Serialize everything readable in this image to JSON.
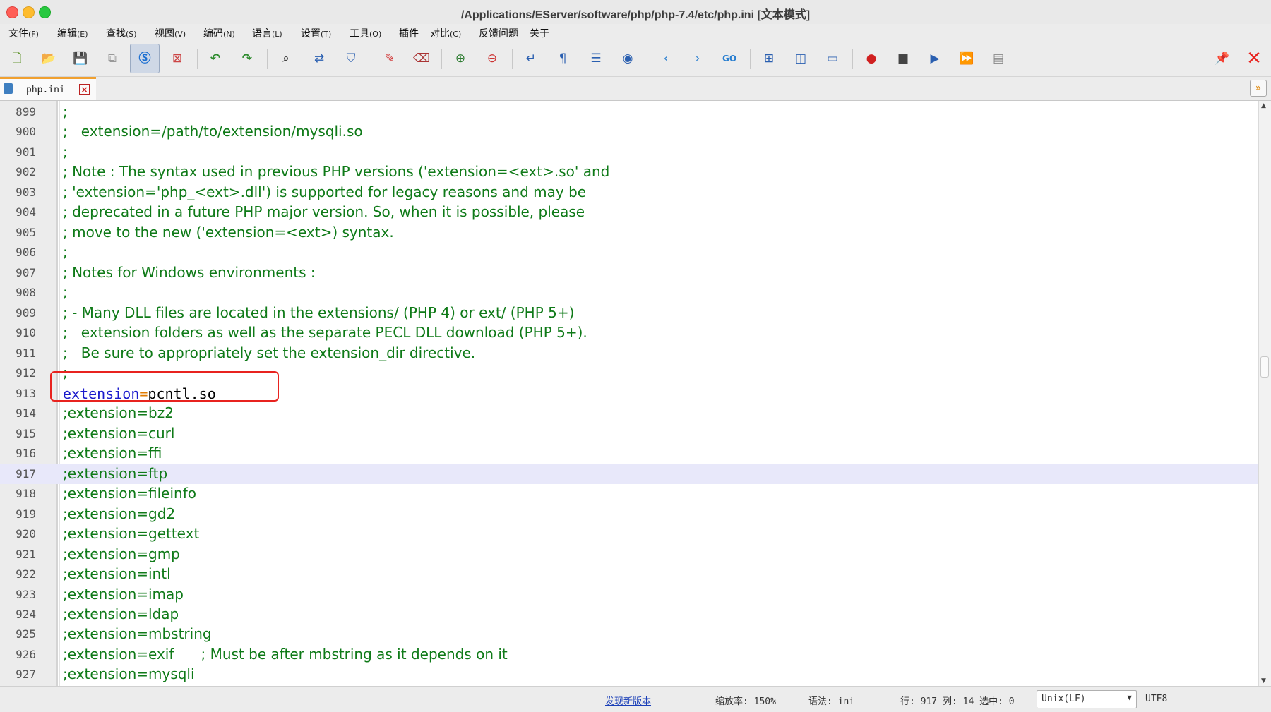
{
  "window": {
    "title": "/Applications/EServer/software/php/php-7.4/etc/php.ini [文本模式]"
  },
  "menu": [
    {
      "label": "文件",
      "accel": "(F)"
    },
    {
      "label": "编辑",
      "accel": "(E)"
    },
    {
      "label": "查找",
      "accel": "(S)"
    },
    {
      "label": "视图",
      "accel": "(V)"
    },
    {
      "label": "编码",
      "accel": "(N)"
    },
    {
      "label": "语言",
      "accel": "(L)"
    },
    {
      "label": "设置",
      "accel": "(T)"
    },
    {
      "label": "工具",
      "accel": "(O)"
    },
    {
      "label": "插件",
      "accel": ""
    },
    {
      "label": "对比",
      "accel": "(C)"
    },
    {
      "label": "反馈问题",
      "accel": ""
    },
    {
      "label": "关于",
      "accel": ""
    }
  ],
  "toolbar": {
    "icons": [
      "new-file-icon",
      "open-file-icon",
      "save-icon",
      "save-all-icon",
      "text-mode-icon",
      "close-file-icon",
      "undo-icon",
      "redo-icon",
      "find-icon",
      "replace-icon",
      "bookmark-icon",
      "highlight-icon",
      "eraser-icon",
      "zoom-in-icon",
      "zoom-out-icon",
      "wrap-icon",
      "show-all-chars-icon",
      "indent-guide-icon",
      "focus-icon",
      "prev-icon",
      "next-icon",
      "goto-icon",
      "sync-scroll-icon",
      "split-view-icon",
      "monitor-icon",
      "record-macro-icon",
      "stop-macro-icon",
      "play-macro-icon",
      "run-macro-multiple-icon",
      "save-macro-icon"
    ],
    "pin_icon": "pin-icon",
    "close_icon": "close-icon",
    "accent_color": "#e8231f"
  },
  "tabs": [
    {
      "label": "php.ini",
      "close": "×"
    }
  ],
  "tab_more": "»",
  "editor": {
    "current_line": "917",
    "lines": [
      {
        "num": "899",
        "text": ";"
      },
      {
        "num": "900",
        "text": ";   extension=/path/to/extension/mysqli.so"
      },
      {
        "num": "901",
        "text": ";"
      },
      {
        "num": "902",
        "text": "; Note : The syntax used in previous PHP versions ('extension=<ext>.so' and"
      },
      {
        "num": "903",
        "text": "; 'extension='php_<ext>.dll') is supported for legacy reasons and may be"
      },
      {
        "num": "904",
        "text": "; deprecated in a future PHP major version. So, when it is possible, please"
      },
      {
        "num": "905",
        "text": "; move to the new ('extension=<ext>) syntax."
      },
      {
        "num": "906",
        "text": ";"
      },
      {
        "num": "907",
        "text": "; Notes for Windows environments :"
      },
      {
        "num": "908",
        "text": ";"
      },
      {
        "num": "909",
        "text": "; - Many DLL files are located in the extensions/ (PHP 4) or ext/ (PHP 5+)"
      },
      {
        "num": "910",
        "text": ";   extension folders as well as the separate PECL DLL download (PHP 5+)."
      },
      {
        "num": "911",
        "text": ";   Be sure to appropriately set the extension_dir directive."
      },
      {
        "num": "912",
        "text": ";"
      },
      {
        "num": "913",
        "key": "extension",
        "eq": "=",
        "value": "pcntl.so"
      },
      {
        "num": "914",
        "text": ";extension=bz2"
      },
      {
        "num": "915",
        "text": ";extension=curl"
      },
      {
        "num": "916",
        "text": ";extension=ffi"
      },
      {
        "num": "917",
        "text": ";extension=ftp"
      },
      {
        "num": "918",
        "text": ";extension=fileinfo"
      },
      {
        "num": "919",
        "text": ";extension=gd2"
      },
      {
        "num": "920",
        "text": ";extension=gettext"
      },
      {
        "num": "921",
        "text": ";extension=gmp"
      },
      {
        "num": "922",
        "text": ";extension=intl"
      },
      {
        "num": "923",
        "text": ";extension=imap"
      },
      {
        "num": "924",
        "text": ";extension=ldap"
      },
      {
        "num": "925",
        "text": ";extension=mbstring"
      },
      {
        "num": "926",
        "text": ";extension=exif      ; Must be after mbstring as it depends on it"
      },
      {
        "num": "927",
        "text": ";extension=mysqli"
      }
    ],
    "comment_color": "#0f7a18",
    "key_color": "#1a1acc",
    "eq_color": "#e07b00"
  },
  "status": {
    "update_link": "发现新版本",
    "zoom": "缩放率: 150%",
    "syntax": "语法: ini",
    "position": "行: 917  列: 14  选中: 0",
    "line_ending": "Unix(LF)",
    "encoding": "UTF8"
  }
}
